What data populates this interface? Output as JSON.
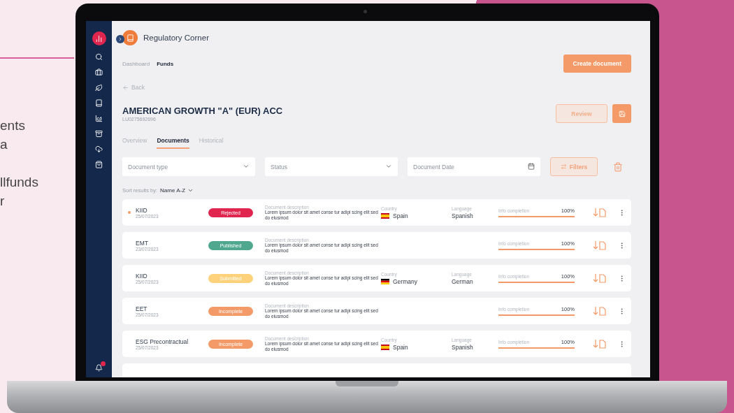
{
  "side_text": [
    "ents",
    "a",
    "llfunds",
    "r"
  ],
  "app": {
    "title": "Regulatory Corner"
  },
  "breadcrumbs": [
    {
      "label": "Dashboard",
      "selected": false
    },
    {
      "label": "Funds",
      "selected": true
    }
  ],
  "create_button": "Create document",
  "back": "Back",
  "fund": {
    "name": "AMERICAN GROWTH \"A\" (EUR) ACC",
    "isin": "LU0275692696"
  },
  "review_button": "Review",
  "tabs": [
    {
      "label": "Overview",
      "selected": false
    },
    {
      "label": "Documents",
      "selected": true
    },
    {
      "label": "Historical",
      "selected": false
    }
  ],
  "filters": {
    "document_type": {
      "placeholder": "Document type"
    },
    "status": {
      "placeholder": "Status"
    },
    "date": {
      "placeholder": "Document Date"
    },
    "button": "Filters"
  },
  "sort": {
    "label": "Sort results by:",
    "value": "Name A-Z"
  },
  "documents": [
    {
      "name": "KIID",
      "date": "25/07/2023",
      "unread": true,
      "status": "Rejected",
      "color": "#e0264f",
      "description_label": "Document description",
      "description": "Lorem ipsum dolor sit amet conse tur adipi scing elit sed do eiusmod",
      "country_label": "Country",
      "country": "Spain",
      "kind": "es",
      "language_label": "Language",
      "language": "Spanish",
      "completion_label": "Info completion",
      "completion": "100%",
      "level": 1
    },
    {
      "name": "EMT",
      "date": "23/07/2023",
      "unread": false,
      "status": "Published",
      "color": "#4fa88e",
      "description_label": "Document description",
      "description": "Lorem ipsum dolor sit amet conse tur adipi scing elit sed do eiusmod",
      "completion_label": "Info completion",
      "completion": "100%",
      "level": 1
    },
    {
      "name": "KIID",
      "date": "25/07/2023",
      "unread": false,
      "status": "Submitted",
      "color": "#fdd27a",
      "description_label": "Document description",
      "description": "Lorem ipsum dolor sit amet conse tur adipi scing elit sed do eiusmod",
      "country_label": "Country",
      "country": "Germany",
      "kind": "de",
      "language_label": "Language",
      "language": "German",
      "completion_label": "Info completion",
      "completion": "100%",
      "level": 1
    },
    {
      "name": "EET",
      "date": "25/07/2023",
      "unread": false,
      "status": "Incomplete",
      "color": "#f39a68",
      "description_label": "Document description",
      "description": "Lorem ipsum dolor sit amet conse tur adipi scing elit sed do eiusmod",
      "completion_label": "Info completion",
      "completion": "100%",
      "level": 1
    },
    {
      "name": "ESG Precontractual",
      "date": "25/07/2023",
      "unread": false,
      "status": "Incomplete",
      "color": "#f39a68",
      "description_label": "Document description",
      "description": "Lorem ipsum dolor sit amet conse tur adipi scing elit sed do eiusmod",
      "country_label": "Country",
      "country": "Spain",
      "kind": "es",
      "language_label": "Language",
      "language": "Spanish",
      "completion_label": "Info completion",
      "completion": "100%",
      "level": 1
    }
  ]
}
